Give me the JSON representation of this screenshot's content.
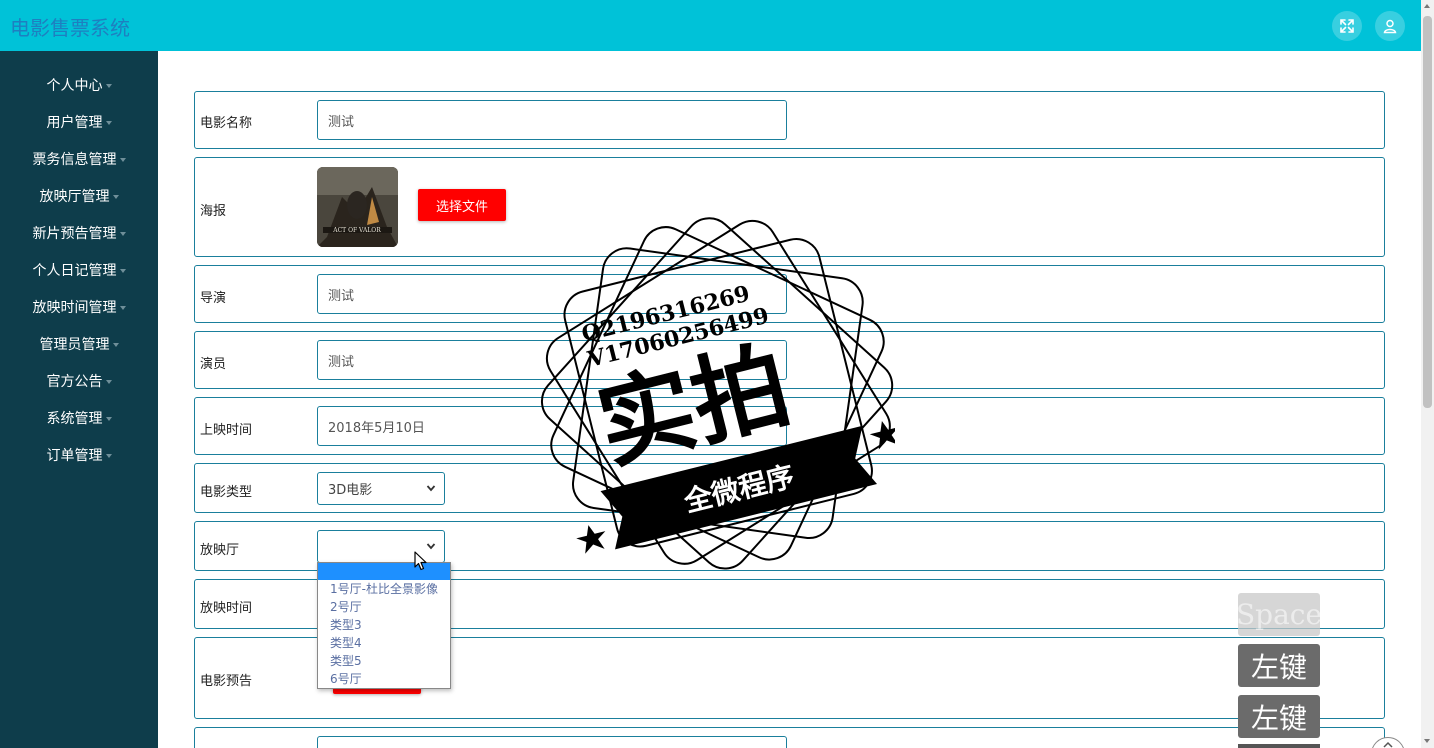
{
  "header": {
    "title": "电影售票系统"
  },
  "sidebar": {
    "items": [
      {
        "label": "个人中心"
      },
      {
        "label": "用户管理"
      },
      {
        "label": "票务信息管理"
      },
      {
        "label": "放映厅管理"
      },
      {
        "label": "新片预告管理"
      },
      {
        "label": "个人日记管理"
      },
      {
        "label": "放映时间管理"
      },
      {
        "label": "管理员管理"
      },
      {
        "label": "官方公告"
      },
      {
        "label": "系统管理"
      },
      {
        "label": "订单管理"
      }
    ]
  },
  "form": {
    "movie_name": {
      "label": "电影名称",
      "value": "测试"
    },
    "poster": {
      "label": "海报",
      "button": "选择文件",
      "poster_text": "ACT OF VALOR"
    },
    "director": {
      "label": "导演",
      "value": "测试"
    },
    "actor": {
      "label": "演员",
      "value": "测试"
    },
    "release_date": {
      "label": "上映时间",
      "value": "2018年5月10日"
    },
    "movie_type": {
      "label": "电影类型",
      "value": "3D电影"
    },
    "hall": {
      "label": "放映厅",
      "value": ""
    },
    "show_time": {
      "label": "放映时间"
    },
    "trailer": {
      "label": "电影预告"
    }
  },
  "dropdown": {
    "options": [
      "",
      "1号厅-杜比全景影像",
      "2号厅",
      "类型3",
      "类型4",
      "类型5",
      "6号厅"
    ]
  },
  "watermark": {
    "line1": "Q2196316269",
    "line2": "V17060256499",
    "big": "实拍",
    "ribbon": "全微程序"
  },
  "keys": {
    "space": "Space",
    "left_click_1": "左键",
    "left_click_2": "左键"
  },
  "colors": {
    "header_bg": "#00c2d8",
    "sidebar_bg": "#0e3d4b",
    "accent": "#1a7f9c",
    "button_red": "#ff0000",
    "dropdown_highlight": "#1e90ff"
  }
}
